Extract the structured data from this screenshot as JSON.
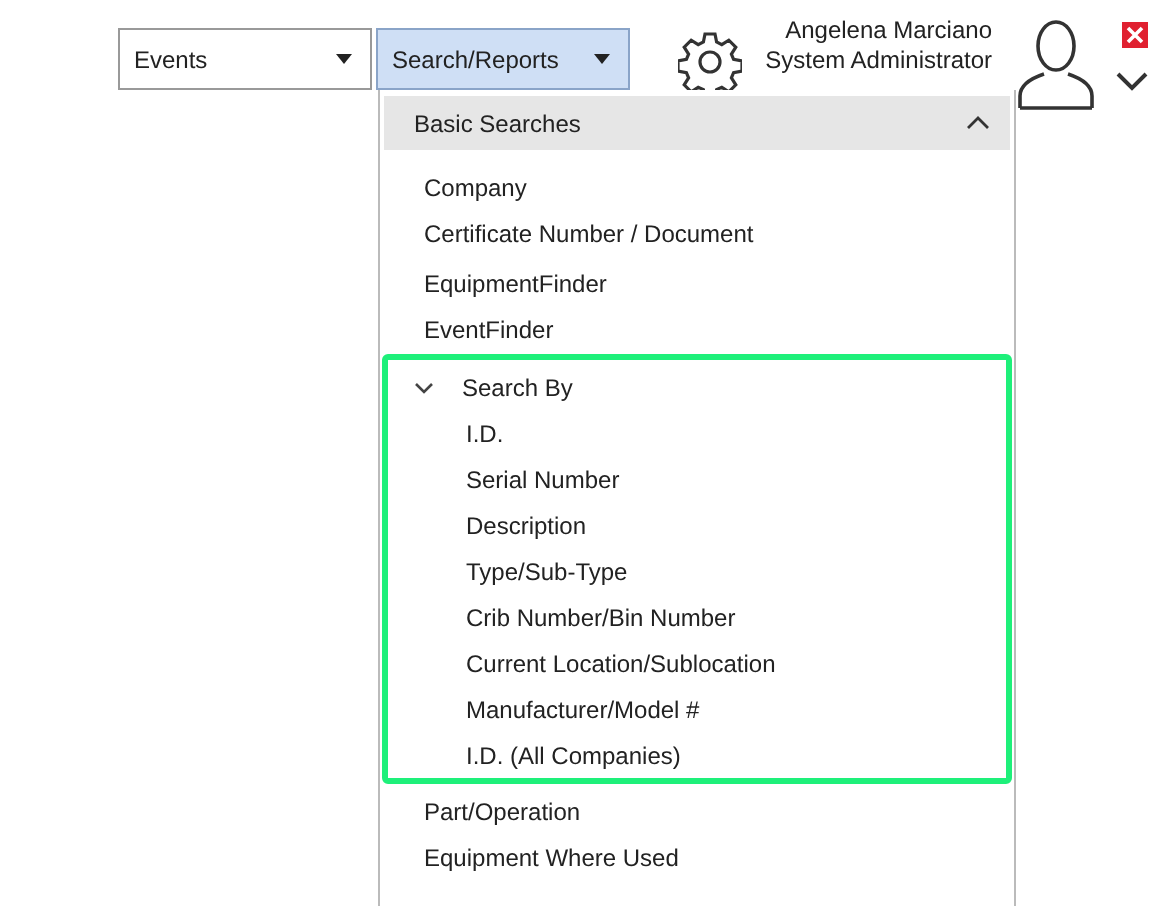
{
  "dropdowns": [
    {
      "label": "Events",
      "selected": false
    },
    {
      "label": "Search/Reports",
      "selected": true
    }
  ],
  "user": {
    "name": "Angelena Marciano",
    "role": "System Administrator"
  },
  "menu": {
    "header": {
      "label": "Basic Searches",
      "expanded": true
    },
    "items": [
      {
        "label": "Company"
      },
      {
        "label": "Certificate Number / Document"
      },
      {
        "label": "EquipmentFinder"
      },
      {
        "label": "EventFinder"
      },
      {
        "label": "Search By",
        "expanded": true,
        "highlighted": true,
        "children": [
          {
            "label": "I.D."
          },
          {
            "label": "Serial Number"
          },
          {
            "label": "Description"
          },
          {
            "label": "Type/Sub-Type"
          },
          {
            "label": "Crib Number/Bin Number"
          },
          {
            "label": "Current Location/Sublocation"
          },
          {
            "label": "Manufacturer/Model #"
          },
          {
            "label": "I.D. (All Companies)"
          }
        ]
      },
      {
        "label": "Part/Operation"
      },
      {
        "label": "Equipment Where Used"
      }
    ]
  }
}
